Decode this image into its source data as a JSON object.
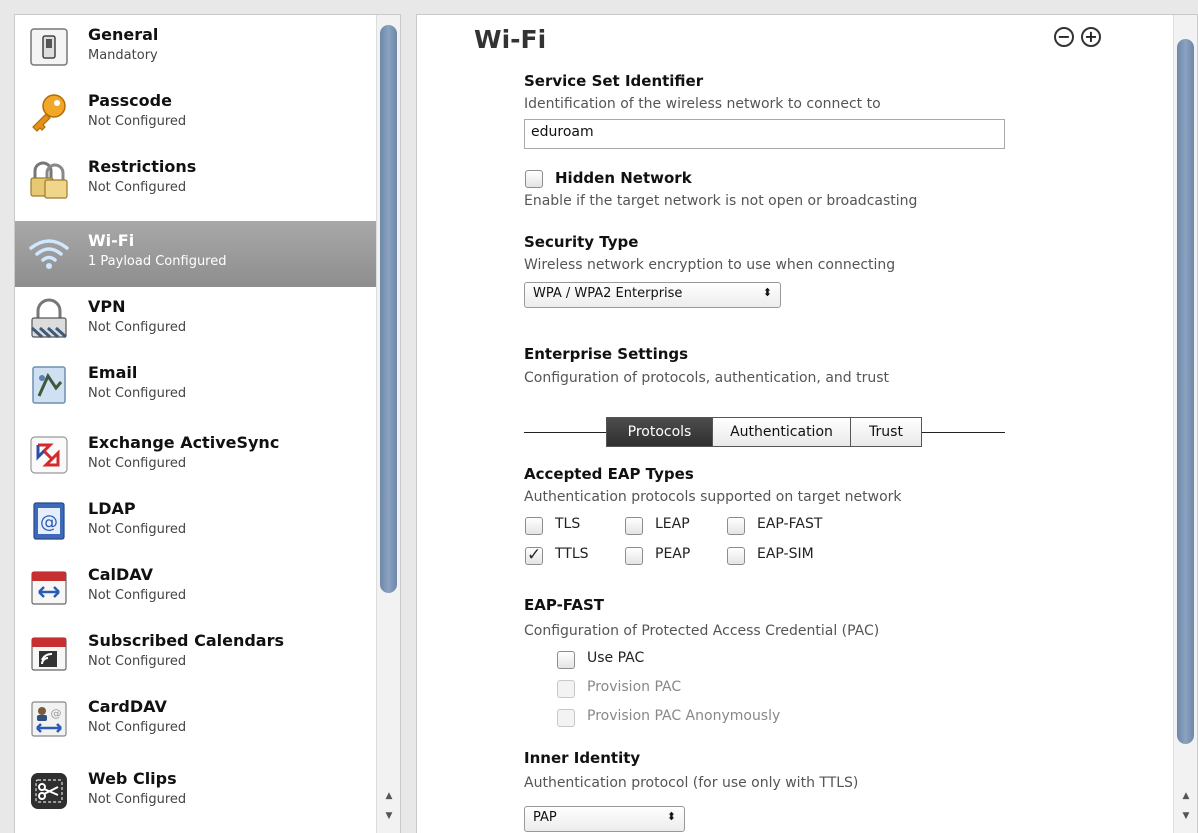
{
  "sidebar": {
    "items": [
      {
        "title": "General",
        "subtitle": "Mandatory",
        "icon": "switch-icon"
      },
      {
        "title": "Passcode",
        "subtitle": "Not Configured",
        "icon": "key-icon"
      },
      {
        "title": "Restrictions",
        "subtitle": "Not Configured",
        "icon": "padlock-icon"
      },
      {
        "title": "Wi-Fi",
        "subtitle": "1 Payload Configured",
        "icon": "wifi-icon",
        "selected": true
      },
      {
        "title": "VPN",
        "subtitle": "Not Configured",
        "icon": "vpn-lock-icon"
      },
      {
        "title": "Email",
        "subtitle": "Not Configured",
        "icon": "email-stamp-icon"
      },
      {
        "title": "Exchange ActiveSync",
        "subtitle": "Not Configured",
        "icon": "exchange-icon"
      },
      {
        "title": "LDAP",
        "subtitle": "Not Configured",
        "icon": "ldap-at-icon"
      },
      {
        "title": "CalDAV",
        "subtitle": "Not Configured",
        "icon": "calendar-sync-icon"
      },
      {
        "title": "Subscribed Calendars",
        "subtitle": "Not Configured",
        "icon": "calendar-subscribe-icon"
      },
      {
        "title": "CardDAV",
        "subtitle": "Not Configured",
        "icon": "contacts-sync-icon"
      },
      {
        "title": "Web Clips",
        "subtitle": "Not Configured",
        "icon": "scissors-icon"
      }
    ]
  },
  "main": {
    "title": "Wi-Fi",
    "ssid": {
      "label": "Service Set Identifier",
      "description": "Identification of the wireless network to connect to",
      "value": "eduroam"
    },
    "hidden_network": {
      "label": "Hidden Network",
      "description": "Enable if the target network is not open or broadcasting",
      "checked": false
    },
    "security_type": {
      "label": "Security Type",
      "description": "Wireless network encryption to use when connecting",
      "value": "WPA / WPA2 Enterprise"
    },
    "enterprise": {
      "label": "Enterprise Settings",
      "description": "Configuration of protocols, authentication, and trust"
    },
    "tabs": [
      {
        "label": "Protocols",
        "active": true
      },
      {
        "label": "Authentication",
        "active": false
      },
      {
        "label": "Trust",
        "active": false
      }
    ],
    "eap_types": {
      "label": "Accepted EAP Types",
      "description": "Authentication protocols supported on target network",
      "options": [
        {
          "label": "TLS",
          "checked": false
        },
        {
          "label": "LEAP",
          "checked": false
        },
        {
          "label": "EAP-FAST",
          "checked": false
        },
        {
          "label": "TTLS",
          "checked": true
        },
        {
          "label": "PEAP",
          "checked": false
        },
        {
          "label": "EAP-SIM",
          "checked": false
        }
      ]
    },
    "eap_fast": {
      "label": "EAP-FAST",
      "description": "Configuration of Protected Access Credential (PAC)",
      "options": [
        {
          "label": "Use PAC",
          "checked": false,
          "enabled": true
        },
        {
          "label": "Provision PAC",
          "checked": false,
          "enabled": false
        },
        {
          "label": "Provision PAC Anonymously",
          "checked": false,
          "enabled": false
        }
      ]
    },
    "inner_identity": {
      "label": "Inner Identity",
      "description": "Authentication protocol (for use only with TTLS)",
      "value": "PAP"
    }
  },
  "colors": {
    "selected_row": "#999999",
    "scroll_thumb": "#7b93b3",
    "active_tab": "#3a3a3a"
  }
}
